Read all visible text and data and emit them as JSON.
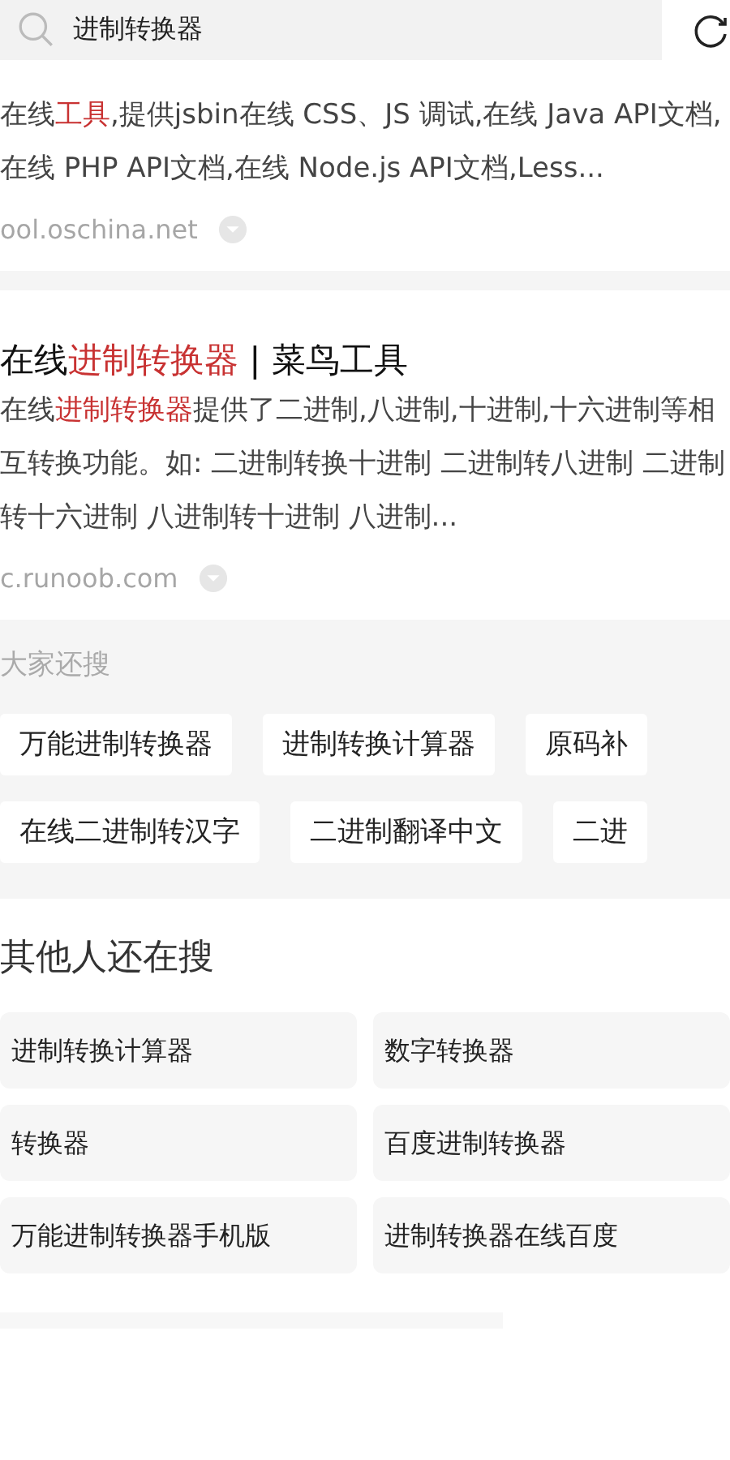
{
  "search": {
    "value": "进制转换器"
  },
  "results": [
    {
      "snippet": [
        {
          "text": "在线",
          "highlight": false
        },
        {
          "text": "工具",
          "highlight": true
        },
        {
          "text": ",提供jsbin在线 CSS、JS 调试,在线 Java API文档,在线 PHP API文档,在线 Node.js API文档,Less...",
          "highlight": false
        }
      ],
      "source": "ool.oschina.net"
    },
    {
      "title": [
        {
          "text": "在线",
          "highlight": false
        },
        {
          "text": "进制转换器",
          "highlight": true
        },
        {
          "text": " | 菜鸟工具",
          "highlight": false
        }
      ],
      "snippet": [
        {
          "text": "在线",
          "highlight": false
        },
        {
          "text": "进制转换器",
          "highlight": true
        },
        {
          "text": "提供了二进制,八进制,十进制,十六进制等相互转换功能。如: 二进制转换十进制 二进制转八进制 二进制转十六进制 八进制转十进制 八进制...",
          "highlight": false
        }
      ],
      "source": "c.runoob.com"
    }
  ],
  "also_searched": {
    "title": "大家还搜",
    "rows": [
      [
        "万能进制转换器",
        "进制转换计算器",
        "原码补"
      ],
      [
        "在线二进制转汉字",
        "二进制翻译中文",
        "二进"
      ]
    ]
  },
  "others_searched": {
    "title": "其他人还在搜",
    "items": [
      "进制转换计算器",
      "数字转换器",
      "转换器",
      "百度进制转换器",
      "万能进制转换器手机版",
      "进制转换器在线百度"
    ]
  }
}
